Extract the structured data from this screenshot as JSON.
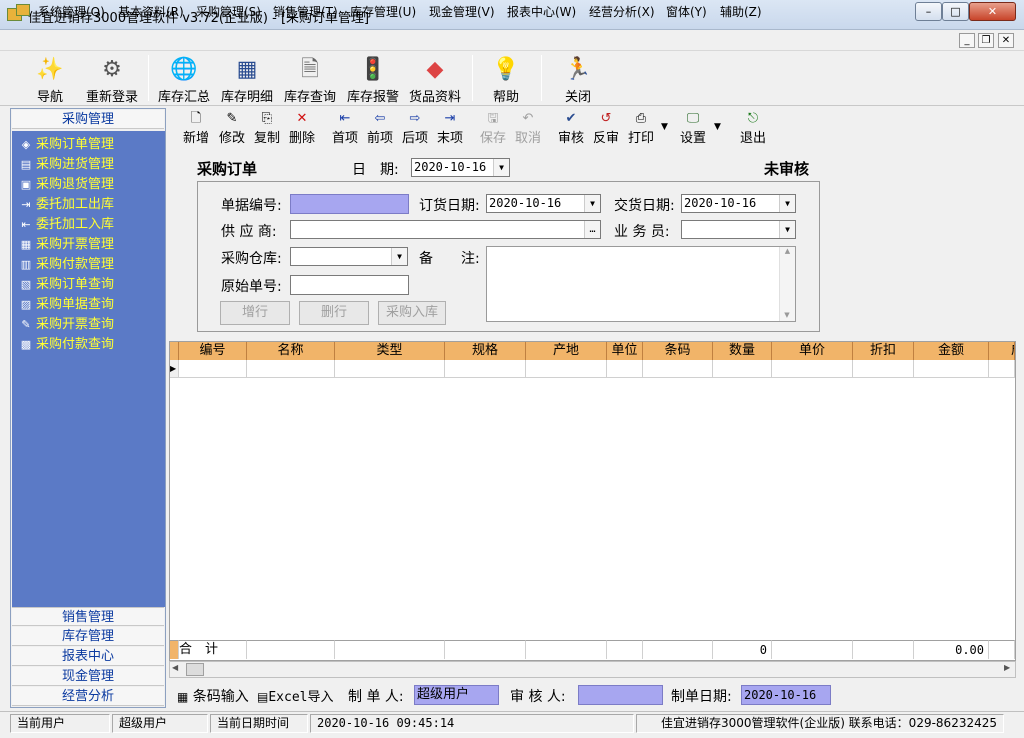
{
  "window": {
    "title": "佳宜进销存3000管理软件 v3.72(企业版) - [采购订单管理]",
    "min": "–",
    "max": "□",
    "close": "✕"
  },
  "menu": [
    "系统管理(Q)",
    "基本资料(R)",
    "采购管理(S)",
    "销售管理(T)",
    "库存管理(U)",
    "现金管理(V)",
    "报表中心(W)",
    "经营分析(X)",
    "窗体(Y)",
    "辅助(Z)"
  ],
  "mdi": {
    "min": "_",
    "restore": "❐",
    "close": "✕"
  },
  "toolbar": [
    "导航",
    "重新登录",
    "库存汇总",
    "库存明细",
    "库存查询",
    "库存报警",
    "货品资料",
    "帮助",
    "关闭"
  ],
  "left_panel": {
    "active_section": "采购管理",
    "items": [
      "采购订单管理",
      "采购进货管理",
      "采购退货管理",
      "委托加工出库",
      "委托加工入库",
      "采购开票管理",
      "采购付款管理",
      "采购订单查询",
      "采购单据查询",
      "采购开票查询",
      "采购付款查询"
    ],
    "sections": [
      "销售管理",
      "库存管理",
      "报表中心",
      "现金管理",
      "经营分析"
    ]
  },
  "subtoolbar": [
    "新增",
    "修改",
    "复制",
    "删除",
    "首项",
    "前项",
    "后项",
    "末项",
    "保存",
    "取消",
    "审核",
    "反审",
    "打印",
    "设置",
    "退出"
  ],
  "form": {
    "title": "采购订单",
    "date_label": "日　期:",
    "date_value": "2020-10-16",
    "status": "未审核",
    "doc_no_label": "单据编号:",
    "doc_no_value": "",
    "order_date_label": "订货日期:",
    "order_date_value": "2020-10-16",
    "delivery_date_label": "交货日期:",
    "delivery_date_value": "2020-10-16",
    "supplier_label": "供 应 商:",
    "supplier_value": "",
    "salesman_label": "业 务 员:",
    "salesman_value": "",
    "warehouse_label": "采购仓库:",
    "warehouse_value": "",
    "remark_label": "备　　注:",
    "remark_value": "",
    "orig_no_label": "原始单号:",
    "orig_no_value": "",
    "add_row": "增行",
    "del_row": "删行",
    "purchase_in": "采购入库"
  },
  "grid": {
    "columns": [
      "编号",
      "名称",
      "类型",
      "规格",
      "产地",
      "单位",
      "条码",
      "数量",
      "单价",
      "折扣",
      "金额",
      "成"
    ],
    "total_label": "合　计",
    "total_qty": "0",
    "total_amount": "0.00"
  },
  "bottom": {
    "barcode_input": "条码输入",
    "excel_import": "Excel导入",
    "maker_label": "制 单 人:",
    "maker_value": "超级用户",
    "auditor_label": "审 核 人:",
    "auditor_value": "",
    "make_date_label": "制单日期:",
    "make_date_value": "2020-10-16"
  },
  "statusbar": {
    "user_label": "当前用户",
    "user_value": "超级用户",
    "time_label": "当前日期时间",
    "time_value": "2020-10-16 09:45:14",
    "info": "佳宜进销存3000管理软件(企业版) 联系电话：029-86232425"
  }
}
